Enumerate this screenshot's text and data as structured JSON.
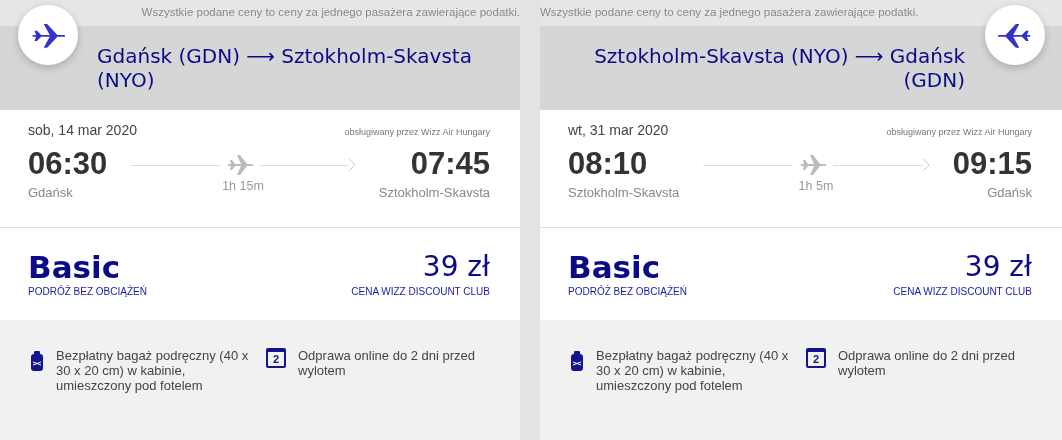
{
  "flights": [
    {
      "kind": "outbound",
      "notice": "Wszystkie podane ceny to ceny za jednego pasażera zawierające podatki.",
      "route": "Gdańsk (GDN) ⟶ Sztokholm-Skavsta (NYO)",
      "date": "sob, 14 mar 2020",
      "operator": "obsługiwany przez Wizz Air Hungary",
      "departure_time": "06:30",
      "departure_city": "Gdańsk",
      "duration": "1h 15m",
      "arrival_time": "07:45",
      "arrival_city": "Sztokholm-Skavsta",
      "fare": "Basic",
      "fare_subtitle": "PODRÓŻ BEZ OBCIĄŻEŃ",
      "price": "39 zł",
      "price_note": "CENA WIZZ DISCOUNT CLUB",
      "features": [
        {
          "kind": "bag",
          "text": "Bezpłatny bagaż podręczny (40 x 30 x 20 cm) w kabinie, umieszczony pod fotelem"
        },
        {
          "kind": "calendar",
          "icon_text": "2",
          "text": "Odprawa online do 2 dni przed wylotem"
        }
      ]
    },
    {
      "kind": "return",
      "notice": "Wszystkie podane ceny to ceny za jednego pasażera zawierające podatki.",
      "route": "Sztokholm-Skavsta (NYO) ⟶ Gdańsk (GDN)",
      "date": "wt, 31 mar 2020",
      "operator": "obsługiwany przez Wizz Air Hungary",
      "departure_time": "08:10",
      "departure_city": "Sztokholm-Skavsta",
      "duration": "1h 5m",
      "arrival_time": "09:15",
      "arrival_city": "Gdańsk",
      "fare": "Basic",
      "fare_subtitle": "PODRÓŻ BEZ OBCIĄŻEŃ",
      "price": "39 zł",
      "price_note": "CENA WIZZ DISCOUNT CLUB",
      "features": [
        {
          "kind": "bag",
          "text": "Bezpłatny bagaż podręczny (40 x 30 x 20 cm) w kabinie, umieszczony pod fotelem"
        },
        {
          "kind": "calendar",
          "icon_text": "2",
          "text": "Odprawa online do 2 dni przed wylotem"
        }
      ]
    }
  ]
}
